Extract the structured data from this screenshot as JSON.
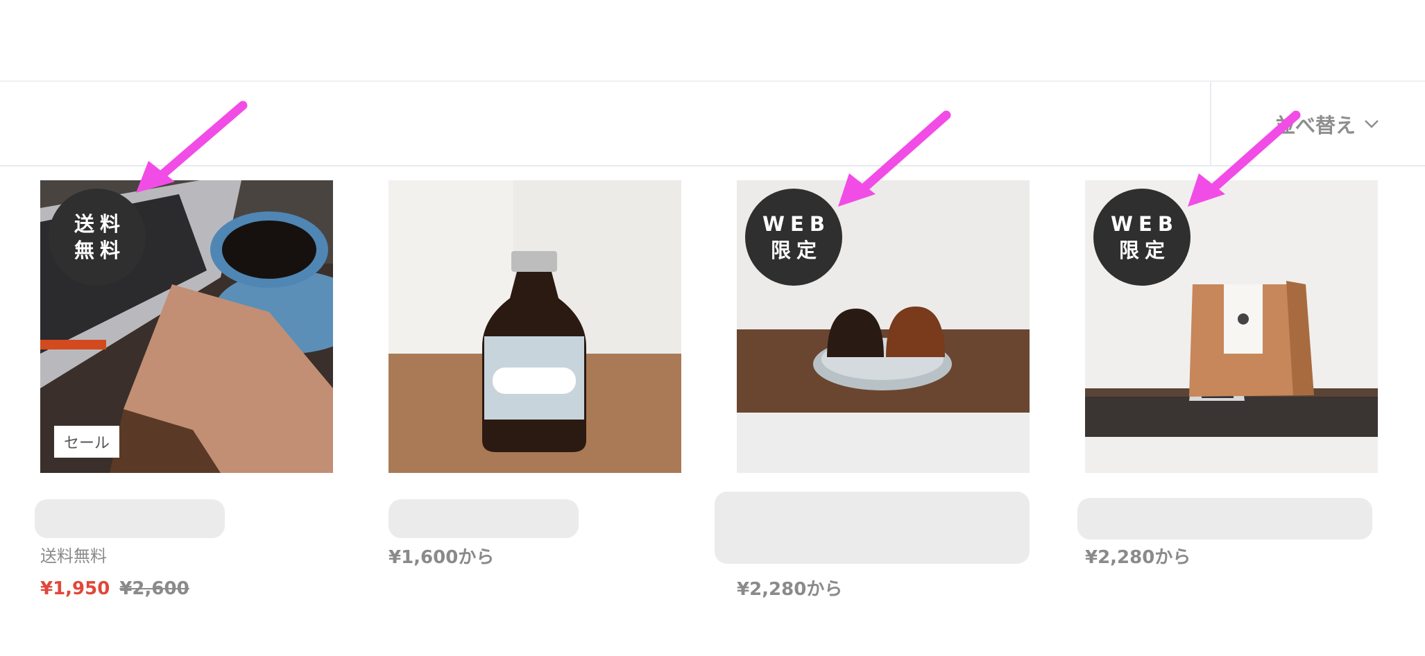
{
  "toolbar": {
    "sort_label": "並べ替え",
    "sort_icon": "chevron-down-icon"
  },
  "products": [
    {
      "badge_line1": "送料",
      "badge_line2": "無料",
      "sale_tag": "セール",
      "sub_label": "送料無料",
      "price": "¥1,950",
      "old_price": "¥2,600"
    },
    {
      "price": "¥1,600から"
    },
    {
      "badge_line1": "WEB",
      "badge_line2": "限定",
      "price": "¥2,280から"
    },
    {
      "badge_line1": "WEB",
      "badge_line2": "限定",
      "price": "¥2,280から"
    }
  ],
  "colors": {
    "badge_bg": "#2f2f2f",
    "sale_price": "#e0473a",
    "annotation_arrow": "#f24ce6",
    "placeholder": "#ebebeb"
  }
}
